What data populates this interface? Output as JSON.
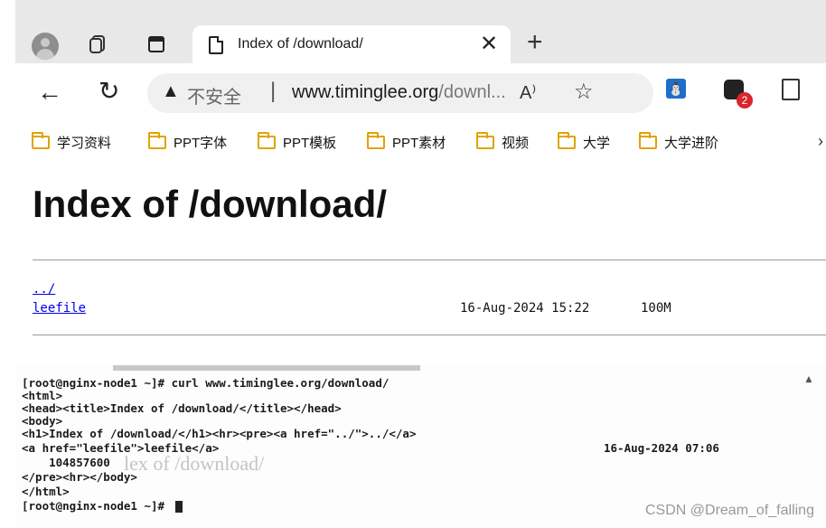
{
  "browser": {
    "tab_title": "Index of /download/",
    "tab_close": "✕",
    "new_tab": "+",
    "nav": {
      "back": "←",
      "reload": "↻"
    },
    "address": {
      "security_icon": "▲",
      "security_label": "不安全",
      "separator": "|",
      "url_host": "www.timinglee.org",
      "url_path": "/downl...",
      "read_aloud": "A⁾",
      "favorite": "☆"
    },
    "extensions": {
      "badge_count": "2",
      "ext1_glyph": "⛄"
    },
    "bookmarks": [
      "学习资料",
      "PPT字体",
      "PPT模板",
      "PPT素材",
      "视频",
      "大学",
      "大学进阶"
    ],
    "bookmarks_more": "›"
  },
  "page": {
    "heading": "Index of /download/",
    "entries": [
      {
        "name": "../",
        "date": "",
        "size": ""
      },
      {
        "name": "leefile",
        "date": "16-Aug-2024 15:22",
        "size": "100M"
      }
    ]
  },
  "terminal": {
    "lines": [
      "[root@nginx-node1 ~]# curl www.timinglee.org/download/",
      "<html>",
      "<head><title>Index of /download/</title></head>",
      "<body>",
      "<h1>Index of /download/</h1><hr><pre><a href=\"../\">../</a>",
      "<a href=\"leefile\">leefile</a>",
      "    104857600",
      "</pre><hr></body>",
      "</html>",
      "[root@nginx-node1 ~]# "
    ],
    "date": "16-Aug-2024 07:06",
    "ghost_heading": "lex of /download/",
    "scroll_up": "▲"
  },
  "watermark": "CSDN @Dream_of_falling",
  "colors": {
    "link": "#0000ee",
    "folder": "#e0a400",
    "badge": "#d9262c",
    "tabbar": "#e8e8e8"
  },
  "icons": [
    "profile-avatar-icon",
    "workspaces-icon",
    "tab-actions-icon",
    "page-icon",
    "warning-icon",
    "star-icon",
    "extension-icon",
    "collections-icon",
    "folder-icon"
  ]
}
